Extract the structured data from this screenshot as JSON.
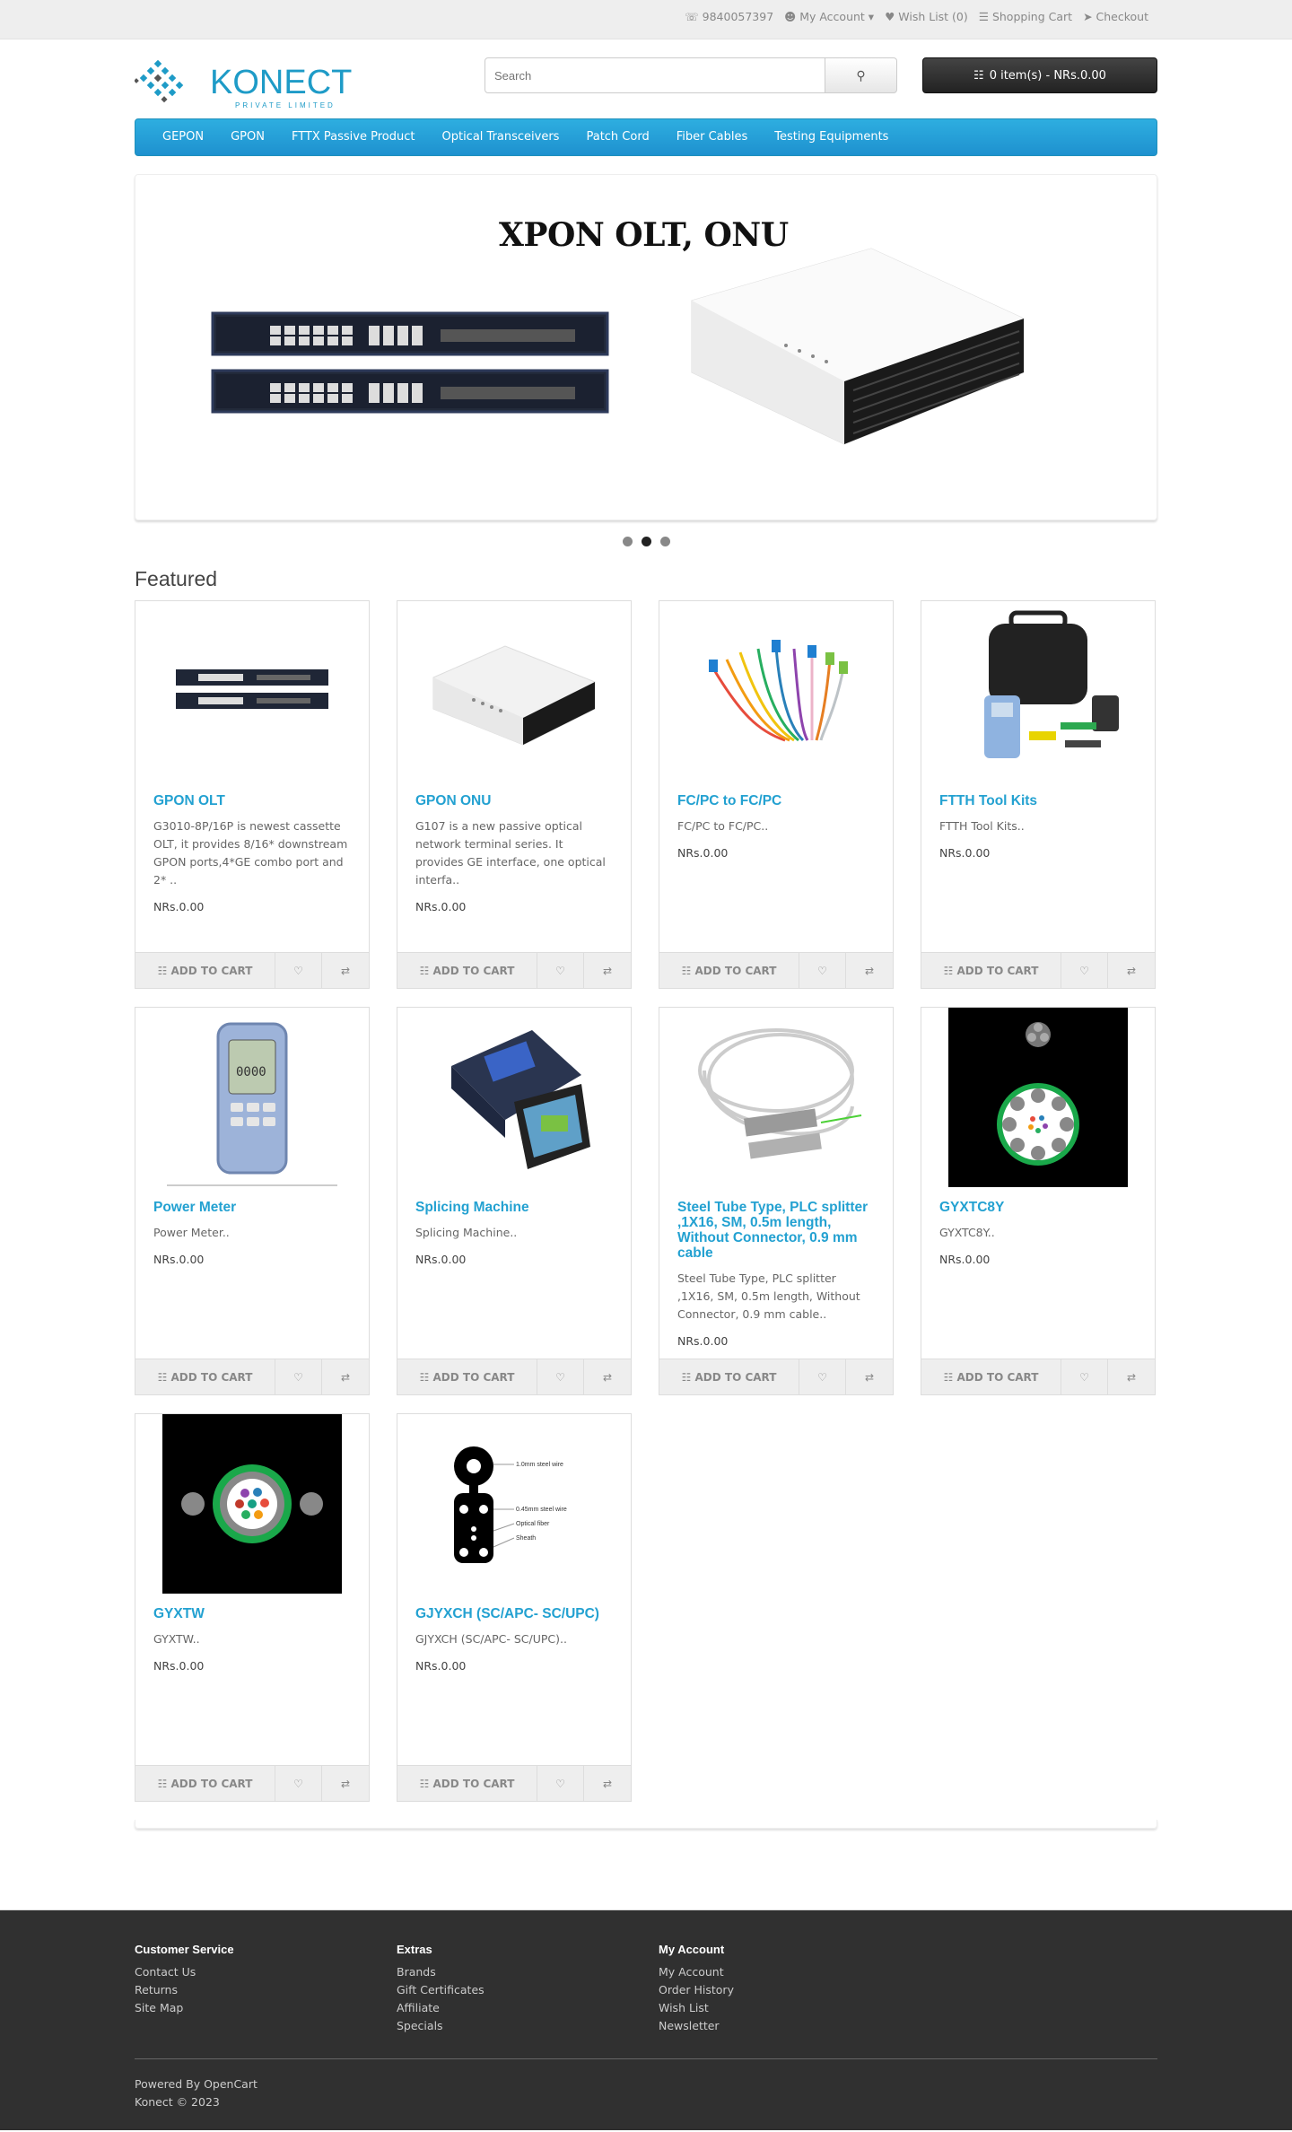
{
  "top_links": {
    "phone": "9840057397",
    "my_account": "My Account",
    "wishlist": "Wish List (0)",
    "cart": "Shopping Cart",
    "checkout": "Checkout"
  },
  "logo": {
    "name": "KONECT",
    "tagline": "PRIVATE LIMITED"
  },
  "search": {
    "placeholder": "Search"
  },
  "cart_summary": "0 item(s) - NRs.0.00",
  "menu": [
    "GEPON",
    "GPON",
    "FTTX Passive Product",
    "Optical Transceivers",
    "Patch Cord",
    "Fiber Cables",
    "Testing Equipments"
  ],
  "slideshow": {
    "title": "XPON OLT, ONU",
    "active_index": 1,
    "count": 3
  },
  "featured_heading": "Featured",
  "products": [
    {
      "name": "GPON OLT",
      "desc": "G3010-8P/16P is newest cassette OLT, it provides 8/16* downstream GPON ports,4*GE combo port and 2* ..",
      "price": "NRs.0.00",
      "icon": "olt-image"
    },
    {
      "name": "GPON ONU",
      "desc": "G107 is a new passive optical network terminal series. It provides GE interface, one optical interfa..",
      "price": "NRs.0.00",
      "icon": "onu-image"
    },
    {
      "name": "FC/PC to FC/PC",
      "desc": "FC/PC to FC/PC..",
      "price": "NRs.0.00",
      "icon": "patchcord-image"
    },
    {
      "name": "FTTH Tool Kits",
      "desc": "FTTH Tool Kits..",
      "price": "NRs.0.00",
      "icon": "toolkit-image"
    },
    {
      "name": "Power Meter",
      "desc": "Power Meter..",
      "price": "NRs.0.00",
      "icon": "power-meter-image"
    },
    {
      "name": "Splicing Machine",
      "desc": "Splicing Machine..",
      "price": "NRs.0.00",
      "icon": "splicer-image"
    },
    {
      "name": "Steel Tube Type, PLC splitter ,1X16, SM, 0.5m length, Without Connector, 0.9 mm cable",
      "desc": "Steel Tube Type, PLC splitter ,1X16, SM, 0.5m length, Without Connector, 0.9 mm cable..",
      "price": "NRs.0.00",
      "icon": "splitter-image"
    },
    {
      "name": "GYXTC8Y",
      "desc": "GYXTC8Y..",
      "price": "NRs.0.00",
      "icon": "cable-section-image"
    },
    {
      "name": "GYXTW",
      "desc": "GYXTW..",
      "price": "NRs.0.00",
      "icon": "cable-section-image"
    },
    {
      "name": "GJYXCH (SC/APC- SC/UPC)",
      "desc": "GJYXCH (SC/APC- SC/UPC)..",
      "price": "NRs.0.00",
      "icon": "drop-cable-image"
    }
  ],
  "add_to_cart_label": "ADD TO CART",
  "drop_cable_labels": [
    "1.0mm steel wire",
    "0.45mm steel wire",
    "Optical fiber",
    "Sheath"
  ],
  "footer": {
    "customer_service": {
      "title": "Customer Service",
      "links": [
        "Contact Us",
        "Returns",
        "Site Map"
      ]
    },
    "extras": {
      "title": "Extras",
      "links": [
        "Brands",
        "Gift Certificates",
        "Affiliate",
        "Specials"
      ]
    },
    "my_account": {
      "title": "My Account",
      "links": [
        "My Account",
        "Order History",
        "Wish List",
        "Newsletter"
      ]
    },
    "powered_by": "Powered By OpenCart",
    "copyright": "Konect © 2023"
  },
  "colors": {
    "menu_blue": "#1e91cf",
    "link_blue": "#23a1d1",
    "footer_bg": "#303030"
  }
}
